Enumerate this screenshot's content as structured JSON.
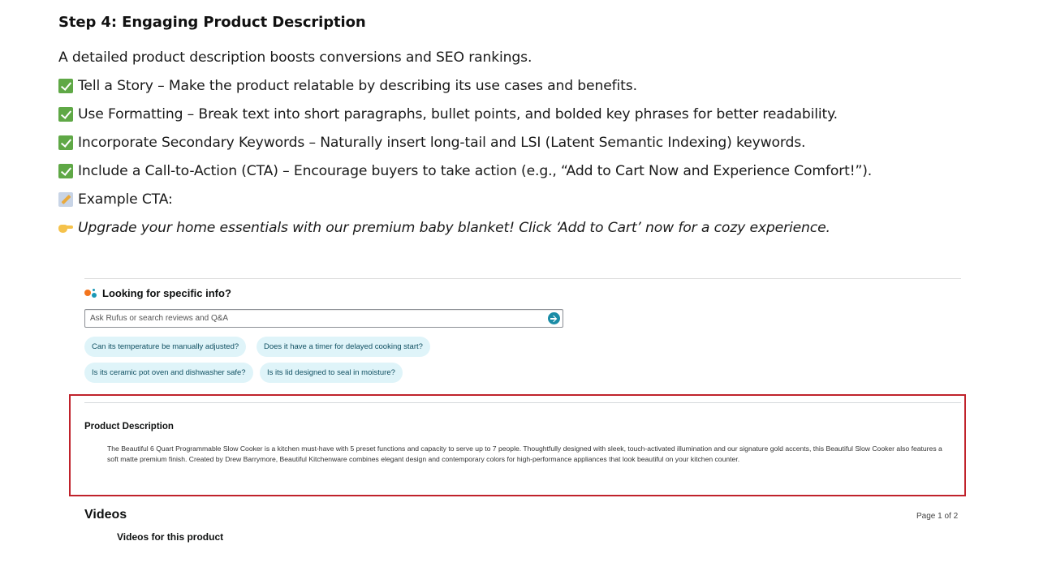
{
  "guide": {
    "step_title": "Step 4: Engaging Product Description",
    "intro": "A detailed product description boosts conversions and SEO rankings.",
    "tips": [
      {
        "icon": "check-mark-icon",
        "text": "Tell a Story – Make the product relatable by describing its use cases and benefits."
      },
      {
        "icon": "check-mark-icon",
        "text": "Use Formatting – Break text into short paragraphs, bullet points, and bolded key phrases for better readability."
      },
      {
        "icon": "check-mark-icon",
        "text": "Incorporate Secondary Keywords – Naturally insert long-tail and LSI (Latent Semantic Indexing) keywords."
      },
      {
        "icon": "check-mark-icon",
        "text": "Include a Call-to-Action (CTA) – Encourage buyers to take action (e.g., “Add to Cart Now and Experience Comfort!”)."
      }
    ],
    "example_label": {
      "icon": "memo-icon",
      "text": "Example CTA:"
    },
    "example_cta": {
      "icon": "pointing-hand-icon",
      "text": "Upgrade your home essentials with our premium baby blanket! Click ‘Add to Cart’ now for a cozy experience."
    }
  },
  "product_page": {
    "rufus": {
      "title": "Looking for specific info?",
      "search_placeholder": "Ask Rufus or search reviews and Q&A",
      "search_value": "",
      "suggestions": [
        "Can its temperature be manually adjusted?",
        "Does it have a timer for delayed cooking start?",
        "Is its ceramic pot oven and dishwasher safe?",
        "Is its lid designed to seal in moisture?"
      ]
    },
    "description": {
      "title": "Product Description",
      "body": "The Beautiful 6 Quart Programmable Slow Cooker is a kitchen must-have with 5 preset functions and capacity to serve up to 7 people. Thoughtfully designed with sleek, touch-activated illumination and our signature gold accents, this Beautiful Slow Cooker also features a soft matte premium finish. Created by Drew Barrymore, Beautiful Kitchenware combines elegant design and contemporary colors for high-performance appliances that look beautiful on your kitchen counter.",
      "highlight_color": "#c0222b"
    },
    "videos": {
      "title": "Videos",
      "subtitle": "Videos for this product",
      "page_indicator": "Page 1 of 2"
    }
  },
  "colors": {
    "check_green": "#5fa846",
    "chip_bg": "#dff4f9",
    "chip_text": "#0f4f61",
    "rufus_orange": "#f3741c",
    "rufus_teal": "#1a98b5"
  }
}
